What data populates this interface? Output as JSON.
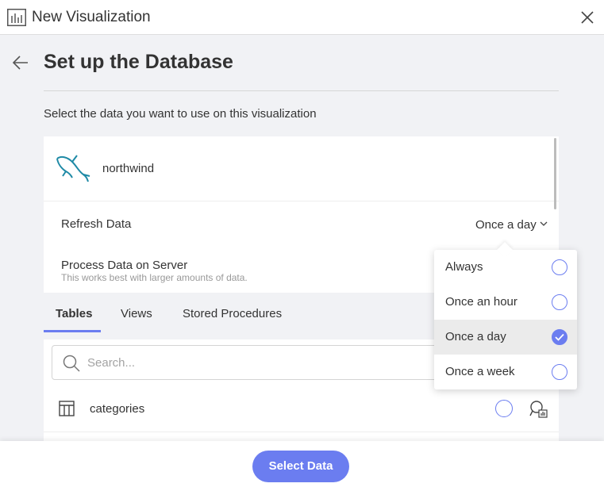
{
  "window": {
    "title": "New Visualization",
    "app_icon": "bar-chart-icon",
    "close_icon": "close-icon"
  },
  "header": {
    "back_icon": "arrow-left-icon",
    "title": "Set up the Database",
    "subtitle": "Select the data you want to use on this visualization"
  },
  "database": {
    "icon": "mysql-dolphin-icon",
    "name": "northwind"
  },
  "refresh": {
    "label": "Refresh Data",
    "value": "Once a day",
    "options": [
      "Always",
      "Once an hour",
      "Once a day",
      "Once a week"
    ],
    "selected_index": 2
  },
  "process": {
    "label": "Process Data on Server",
    "hint": "This works best with larger amounts of data."
  },
  "tabs": [
    {
      "label": "Tables"
    },
    {
      "label": "Views"
    },
    {
      "label": "Stored Procedures"
    }
  ],
  "active_tab": "Tables",
  "search": {
    "placeholder": "Search...",
    "value": ""
  },
  "tables": [
    {
      "name": "categories"
    }
  ],
  "footer": {
    "select_label": "Select Data"
  },
  "colors": {
    "accent": "#6b7df0",
    "mysql": "#1f8aa6"
  }
}
